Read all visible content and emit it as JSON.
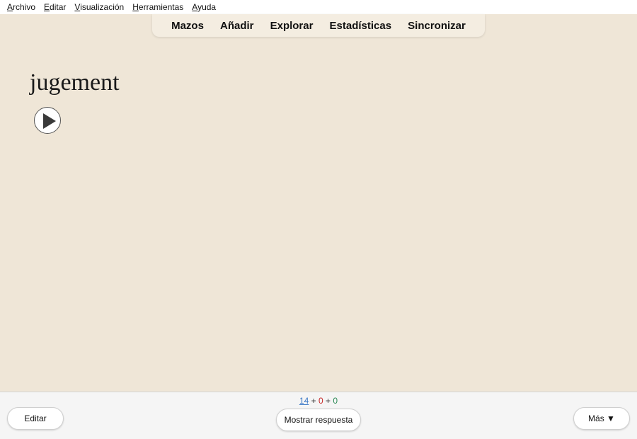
{
  "menubar": {
    "items": [
      {
        "first": "A",
        "rest": "rchivo"
      },
      {
        "first": "E",
        "rest": "ditar"
      },
      {
        "first": "V",
        "rest": "isualización"
      },
      {
        "first": "H",
        "rest": "erramientas"
      },
      {
        "first": "A",
        "rest": "yuda"
      }
    ]
  },
  "toolbar": {
    "items": [
      "Mazos",
      "Añadir",
      "Explorar",
      "Estadísticas",
      "Sincronizar"
    ]
  },
  "card": {
    "front": "jugement",
    "replay_icon": "play-icon"
  },
  "counts": {
    "new": "14",
    "sep1": " + ",
    "learn": "0",
    "sep2": " + ",
    "review": "0"
  },
  "buttons": {
    "edit": "Editar",
    "show_answer": "Mostrar respuesta",
    "more": "Más ▼"
  },
  "colors": {
    "background": "#efe6d7",
    "new_count": "#3b78c6",
    "learn_count": "#c62828",
    "review_count": "#2e8b57"
  }
}
